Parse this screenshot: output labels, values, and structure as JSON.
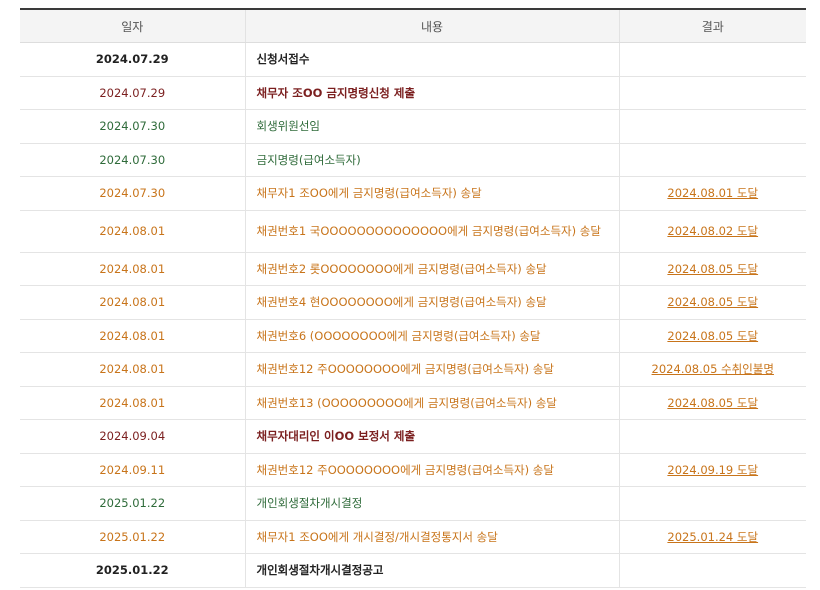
{
  "headers": {
    "date": "일자",
    "content": "내용",
    "result": "결과"
  },
  "colors": {
    "black": "#222222",
    "maroon": "#7b1f1f",
    "green": "#2f6b3a",
    "orange": "#c8741a"
  },
  "rows": [
    {
      "date": "2024.07.29",
      "content": "신청서접수",
      "result": "",
      "style": "black"
    },
    {
      "date": "2024.07.29",
      "content": "채무자 조OO 금지명령신청 제출",
      "result": "",
      "style": "maroon"
    },
    {
      "date": "2024.07.30",
      "content": "회생위원선임",
      "result": "",
      "style": "green"
    },
    {
      "date": "2024.07.30",
      "content": "금지명령(급여소득자)",
      "result": "",
      "style": "green"
    },
    {
      "date": "2024.07.30",
      "content": "채무자1 조OO에게 금지명령(급여소득자) 송달",
      "result": "2024.08.01 도달",
      "style": "orange"
    },
    {
      "date": "2024.08.01",
      "content": "채권번호1 국OOOOOOOOOOOOOO에게 금지명령(급여소득자) 송달",
      "result": "2024.08.02 도달",
      "style": "orange"
    },
    {
      "date": "2024.08.01",
      "content": "채권번호2 롯OOOOOOOO에게 금지명령(급여소득자) 송달",
      "result": "2024.08.05 도달",
      "style": "orange"
    },
    {
      "date": "2024.08.01",
      "content": "채권번호4 현OOOOOOOO에게 금지명령(급여소득자) 송달",
      "result": "2024.08.05 도달",
      "style": "orange"
    },
    {
      "date": "2024.08.01",
      "content": "채권번호6 (OOOOOOOO에게 금지명령(급여소득자) 송달",
      "result": "2024.08.05 도달",
      "style": "orange"
    },
    {
      "date": "2024.08.01",
      "content": "채권번호12 주OOOOOOOO에게 금지명령(급여소득자) 송달",
      "result": "2024.08.05 수취인불명",
      "style": "orange"
    },
    {
      "date": "2024.08.01",
      "content": "채권번호13 (OOOOOOOOO에게 금지명령(급여소득자) 송달",
      "result": "2024.08.05 도달",
      "style": "orange"
    },
    {
      "date": "2024.09.04",
      "content": "채무자대리인 이OO 보정서 제출",
      "result": "",
      "style": "maroon"
    },
    {
      "date": "2024.09.11",
      "content": "채권번호12 주OOOOOOOO에게 금지명령(급여소득자) 송달",
      "result": "2024.09.19 도달",
      "style": "orange"
    },
    {
      "date": "2025.01.22",
      "content": "개인회생절차개시결정",
      "result": "",
      "style": "green"
    },
    {
      "date": "2025.01.22",
      "content": "채무자1 조OO에게 개시결정/개시결정통지서 송달",
      "result": "2025.01.24 도달",
      "style": "orange"
    },
    {
      "date": "2025.01.22",
      "content": "개인회생절차개시결정공고",
      "result": "",
      "style": "black"
    }
  ]
}
